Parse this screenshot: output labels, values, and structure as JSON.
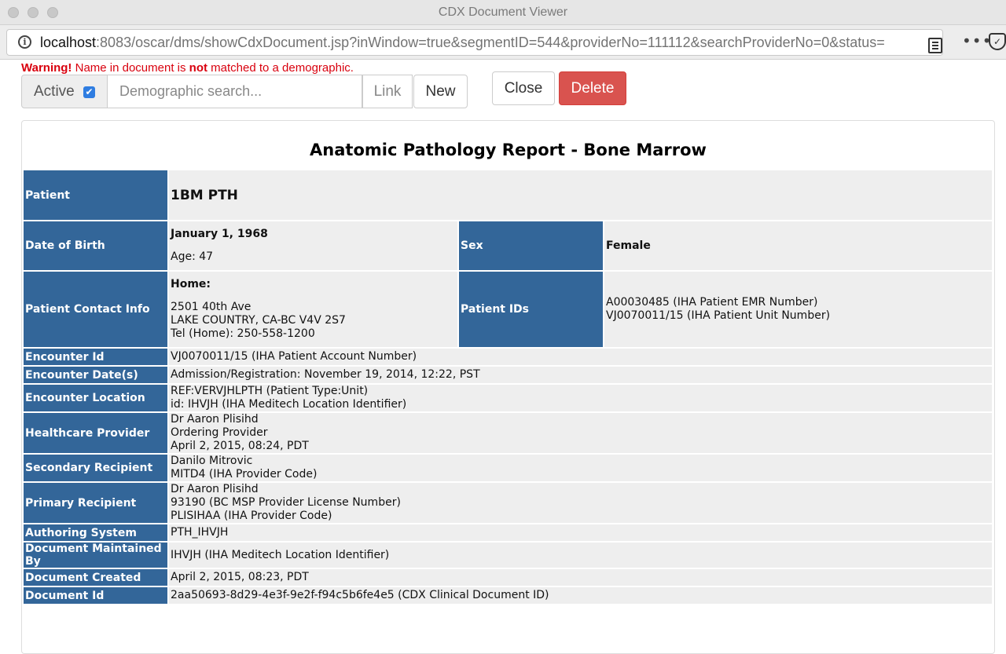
{
  "window": {
    "title": "CDX Document Viewer"
  },
  "browser": {
    "url_host": "localhost",
    "url_rest": ":8083/oscar/dms/showCdxDocument.jsp?inWindow=true&segmentID=544&providerNo=111112&searchProviderNo=0&status=",
    "icons": [
      "info-icon",
      "reader-view-icon",
      "more-icon",
      "pocket-icon"
    ]
  },
  "warning": {
    "prefix": "Warning!",
    "text1": " Name in document is ",
    "emph": "not",
    "text2": " matched to a demographic."
  },
  "toolbar": {
    "active_label": "Active",
    "active_checked": true,
    "search_placeholder": "Demographic search...",
    "link_label": "Link",
    "new_label": "New",
    "close_label": "Close",
    "delete_label": "Delete"
  },
  "colors": {
    "header_cell": "#336699",
    "value_cell": "#eeeeee",
    "warning": "#d9000e",
    "delete_button": "#d9534f"
  },
  "report": {
    "title": "Anatomic Pathology Report - Bone Marrow",
    "patient_label": "Patient",
    "patient_name": "1BM PTH",
    "dob_label": "Date of Birth",
    "dob": "January 1, 1968",
    "age": "Age: 47",
    "sex_label": "Sex",
    "sex": "Female",
    "contact_label": "Patient Contact Info",
    "contact_type": "Home:",
    "contact_street": "2501 40th Ave",
    "contact_city": "LAKE COUNTRY, CA-BC V4V 2S7",
    "contact_tel": "Tel (Home): 250-558-1200",
    "ids_label": "Patient IDs",
    "ids": [
      "A00030485 (IHA Patient EMR Number)",
      "VJ0070011/15 (IHA Patient Unit Number)"
    ],
    "rows": [
      {
        "label": "Encounter Id",
        "lines": [
          "VJ0070011/15 (IHA Patient Account Number)"
        ]
      },
      {
        "label": "Encounter Date(s)",
        "lines": [
          "Admission/Registration: November 19, 2014, 12:22, PST"
        ]
      },
      {
        "label": "Encounter Location",
        "lines": [
          "REF:VERVJHLPTH (Patient Type:Unit)",
          "id: IHVJH (IHA Meditech Location Identifier)"
        ]
      },
      {
        "label": "Healthcare Provider",
        "lines": [
          "Dr Aaron Plisihd",
          "Ordering Provider",
          "April 2, 2015, 08:24, PDT"
        ]
      },
      {
        "label": "Secondary Recipient",
        "lines": [
          "Danilo Mitrovic",
          "MITD4 (IHA Provider Code)"
        ]
      },
      {
        "label": "Primary Recipient",
        "lines": [
          "Dr Aaron Plisihd",
          "93190 (BC MSP Provider License Number)",
          "PLISIHAA (IHA Provider Code)"
        ]
      },
      {
        "label": "Authoring System",
        "lines": [
          "PTH_IHVJH"
        ]
      },
      {
        "label": "Document Maintained By",
        "lines": [
          "IHVJH (IHA Meditech Location Identifier)"
        ]
      },
      {
        "label": "Document Created",
        "lines": [
          "April 2, 2015, 08:23, PDT"
        ]
      },
      {
        "label": "Document Id",
        "lines": [
          "2aa50693-8d29-4e3f-9e2f-f94c5b6fe4e5 (CDX Clinical Document ID)"
        ]
      }
    ]
  }
}
